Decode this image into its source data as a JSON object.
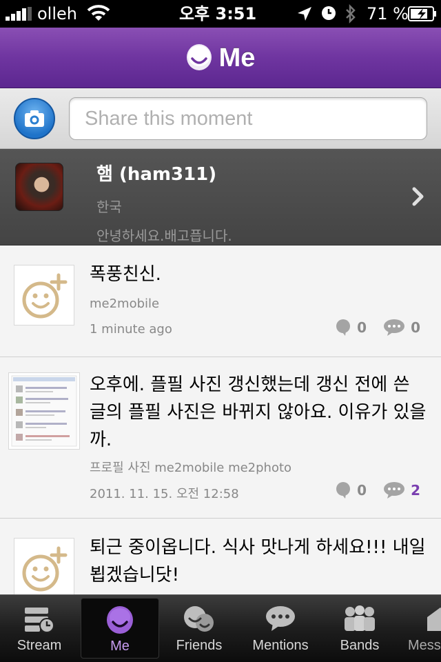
{
  "status_bar": {
    "carrier": "olleh",
    "time": "오후 3:51",
    "battery": "71 %"
  },
  "header": {
    "title": "Me"
  },
  "share": {
    "placeholder": "Share this moment"
  },
  "profile": {
    "name": "햄 (ham311)",
    "country": "한국",
    "bio": "안녕하세요.배고픕니다."
  },
  "posts": [
    {
      "text": "폭풍친신.",
      "tags": "me2mobile",
      "time": "1 minute ago",
      "likes": "0",
      "comments": "0"
    },
    {
      "text": "오후에. 플필 사진 갱신했는데 갱신 전에 쓴 글의 플필 사진은 바뀌지 않아요. 이유가 있을까.",
      "tags": "프로필 사진 me2mobile me2photo",
      "time": "2011. 11. 15. 오전 12:58",
      "likes": "0",
      "comments": "2"
    },
    {
      "text": "퇴근 중이옵니다. 식사 맛나게 하세요!!! 내일 뵙겠습니닷!"
    }
  ],
  "tabs": [
    {
      "label": "Stream",
      "icon": "stream-icon"
    },
    {
      "label": "Me",
      "icon": "me-smile-icon"
    },
    {
      "label": "Friends",
      "icon": "friends-icon"
    },
    {
      "label": "Mentions",
      "icon": "mentions-icon"
    },
    {
      "label": "Bands",
      "icon": "bands-icon"
    },
    {
      "label": "Mess",
      "icon": "messages-icon"
    }
  ],
  "colors": {
    "brand_purple": "#6f35a0",
    "accent_count": "#7a3fb0",
    "camera_blue": "#1f73c9"
  }
}
